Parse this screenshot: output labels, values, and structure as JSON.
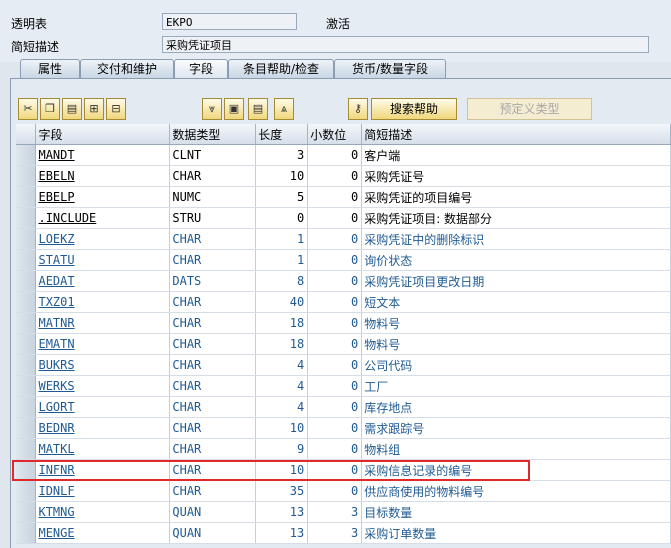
{
  "header": {
    "table_label": "透明表",
    "table_value": "EKPO",
    "status": "激活",
    "desc_label": "简短描述",
    "desc_value": "采购凭证项目"
  },
  "tabs": [
    {
      "label": "属性",
      "active": false
    },
    {
      "label": "交付和维护",
      "active": false
    },
    {
      "label": "字段",
      "active": true
    },
    {
      "label": "条目帮助/检查",
      "active": false
    },
    {
      "label": "货币/数量字段",
      "active": false
    }
  ],
  "toolbar": {
    "icons": [
      "cut-icon",
      "copy-icon",
      "paste-icon",
      "insert-row-icon",
      "delete-row-icon",
      "first-row-icon",
      "prev-page-icon",
      "next-page-icon",
      "last-row-icon",
      "key-icon"
    ],
    "search_help_label": "搜索帮助",
    "predefined_type_label": "预定义类型",
    "accent_color": "#f0d77c"
  },
  "columns": [
    "字段",
    "数据类型",
    "长度",
    "小数位",
    "简短描述"
  ],
  "rows": [
    {
      "field": "MANDT",
      "type": "CLNT",
      "length": "3",
      "decimals": "0",
      "desc": "客户端",
      "color": "black"
    },
    {
      "field": "EBELN",
      "type": "CHAR",
      "length": "10",
      "decimals": "0",
      "desc": "采购凭证号",
      "color": "black"
    },
    {
      "field": "EBELP",
      "type": "NUMC",
      "length": "5",
      "decimals": "0",
      "desc": "采购凭证的项目编号",
      "color": "black"
    },
    {
      "field": ".INCLUDE",
      "type": "STRU",
      "length": "0",
      "decimals": "0",
      "desc": "采购凭证项目: 数据部分",
      "color": "black"
    },
    {
      "field": "LOEKZ",
      "type": "CHAR",
      "length": "1",
      "decimals": "0",
      "desc": "采购凭证中的删除标识",
      "color": "blue"
    },
    {
      "field": "STATU",
      "type": "CHAR",
      "length": "1",
      "decimals": "0",
      "desc": "询价状态",
      "color": "blue"
    },
    {
      "field": "AEDAT",
      "type": "DATS",
      "length": "8",
      "decimals": "0",
      "desc": "采购凭证项目更改日期",
      "color": "blue"
    },
    {
      "field": "TXZ01",
      "type": "CHAR",
      "length": "40",
      "decimals": "0",
      "desc": "短文本",
      "color": "blue"
    },
    {
      "field": "MATNR",
      "type": "CHAR",
      "length": "18",
      "decimals": "0",
      "desc": "物料号",
      "color": "blue"
    },
    {
      "field": "EMATN",
      "type": "CHAR",
      "length": "18",
      "decimals": "0",
      "desc": "物料号",
      "color": "blue"
    },
    {
      "field": "BUKRS",
      "type": "CHAR",
      "length": "4",
      "decimals": "0",
      "desc": "公司代码",
      "color": "blue"
    },
    {
      "field": "WERKS",
      "type": "CHAR",
      "length": "4",
      "decimals": "0",
      "desc": "工厂",
      "color": "blue"
    },
    {
      "field": "LGORT",
      "type": "CHAR",
      "length": "4",
      "decimals": "0",
      "desc": "库存地点",
      "color": "blue"
    },
    {
      "field": "BEDNR",
      "type": "CHAR",
      "length": "10",
      "decimals": "0",
      "desc": "需求跟踪号",
      "color": "blue"
    },
    {
      "field": "MATKL",
      "type": "CHAR",
      "length": "9",
      "decimals": "0",
      "desc": "物料组",
      "color": "blue"
    },
    {
      "field": "INFNR",
      "type": "CHAR",
      "length": "10",
      "decimals": "0",
      "desc": "采购信息记录的编号",
      "color": "blue",
      "highlighted": true
    },
    {
      "field": "IDNLF",
      "type": "CHAR",
      "length": "35",
      "decimals": "0",
      "desc": "供应商使用的物料编号",
      "color": "blue"
    },
    {
      "field": "KTMNG",
      "type": "QUAN",
      "length": "13",
      "decimals": "3",
      "desc": "目标数量",
      "color": "blue"
    },
    {
      "field": "MENGE",
      "type": "QUAN",
      "length": "13",
      "decimals": "3",
      "desc": "采购订单数量",
      "color": "blue"
    }
  ]
}
